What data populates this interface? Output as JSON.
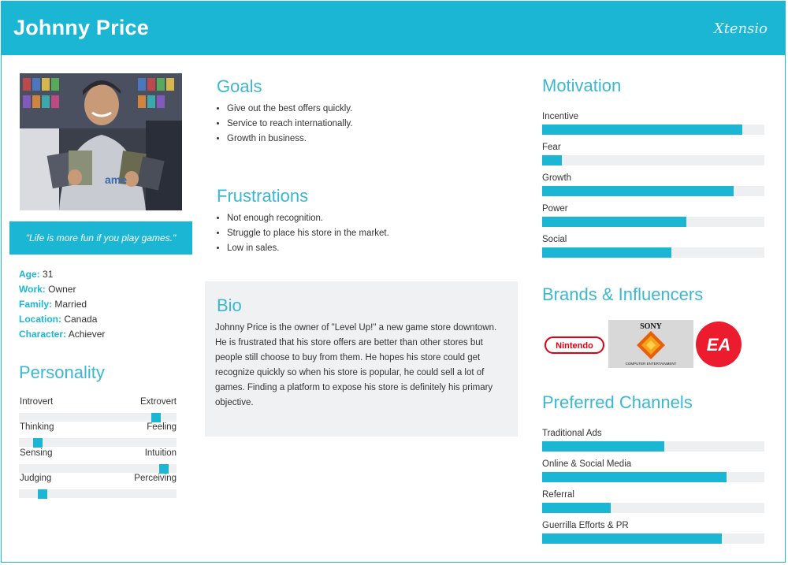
{
  "header": {
    "name": "Johnny Price",
    "logo_text": "Xtensio"
  },
  "profile": {
    "quote": "\"Life is more fun if you play games.\"",
    "facts": [
      {
        "label": "Age:",
        "value": "31"
      },
      {
        "label": "Work:",
        "value": "Owner"
      },
      {
        "label": "Family:",
        "value": "Married"
      },
      {
        "label": "Location:",
        "value": "Canada"
      },
      {
        "label": "Character:",
        "value": "Achiever"
      }
    ]
  },
  "personality": {
    "title": "Personality",
    "scales": [
      {
        "left": "Introvert",
        "right": "Extrovert",
        "level": 0.87
      },
      {
        "left": "Thinking",
        "right": "Feeling",
        "level": 0.12
      },
      {
        "left": "Sensing",
        "right": "Intuition",
        "level": 0.92
      },
      {
        "left": "Judging",
        "right": "Perceiving",
        "level": 0.15
      }
    ]
  },
  "goals": {
    "title": "Goals",
    "items": [
      "Give out the best offers quickly.",
      "Service to reach internationally.",
      "Growth in business."
    ]
  },
  "frustrations": {
    "title": "Frustrations",
    "items": [
      "Not enough recognition.",
      "Struggle to place his store in the market.",
      "Low in sales."
    ]
  },
  "bio": {
    "title": "Bio",
    "text": "Johnny Price is the owner of \"Level Up!\" a new game store downtown. He is frustrated that his store offers are better than other stores but people still choose to buy from them. He hopes his store could get recognize quickly so when his store is popular, he could sell a lot of games. Finding a platform to expose his store is definitely his primary objective."
  },
  "motivation": {
    "title": "Motivation",
    "bars": [
      {
        "label": "Incentive",
        "level": 0.9
      },
      {
        "label": "Fear",
        "level": 0.09
      },
      {
        "label": "Growth",
        "level": 0.86
      },
      {
        "label": "Power",
        "level": 0.65
      },
      {
        "label": "Social",
        "level": 0.58
      }
    ]
  },
  "brands": {
    "title": "Brands & Influencers",
    "nintendo": "Nintendo",
    "sony": "SONY",
    "sony_sub": "COMPUTER ENTERTAINMENT",
    "ea": "EA"
  },
  "channels": {
    "title": "Preferred Channels",
    "bars": [
      {
        "label": "Traditional Ads",
        "level": 0.55
      },
      {
        "label": "Online & Social Media",
        "level": 0.83
      },
      {
        "label": "Referral",
        "level": 0.31
      },
      {
        "label": "Guerrilla Efforts & PR",
        "level": 0.81
      }
    ]
  },
  "colors": {
    "accent": "#1cb6d5",
    "track": "#eeeff1",
    "bio_bg": "#f0f1f3"
  }
}
